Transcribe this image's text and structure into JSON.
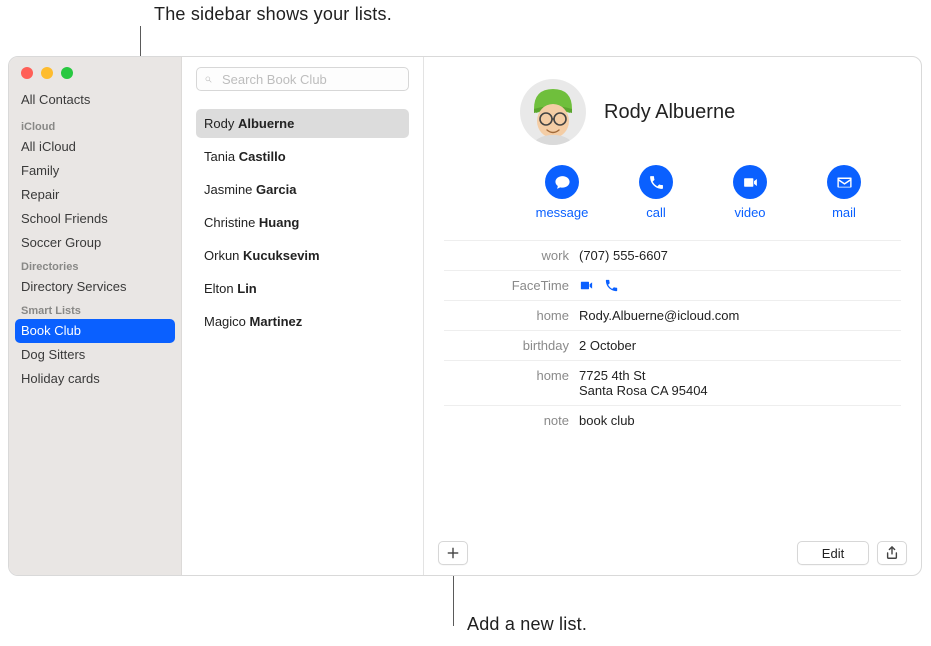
{
  "callouts": {
    "top": "The sidebar shows your lists.",
    "bottom": "Add a new list."
  },
  "sidebar": {
    "all_contacts": "All Contacts",
    "sections": [
      {
        "header": "iCloud",
        "items": [
          "All iCloud",
          "Family",
          "Repair",
          "School Friends",
          "Soccer Group"
        ]
      },
      {
        "header": "Directories",
        "items": [
          "Directory Services"
        ]
      },
      {
        "header": "Smart Lists",
        "items": [
          "Book Club",
          "Dog Sitters",
          "Holiday cards"
        ]
      }
    ],
    "selected": "Book Club"
  },
  "search": {
    "placeholder": "Search Book Club"
  },
  "contacts": [
    {
      "first": "Rody",
      "last": "Albuerne",
      "selected": true
    },
    {
      "first": "Tania",
      "last": "Castillo"
    },
    {
      "first": "Jasmine",
      "last": "Garcia"
    },
    {
      "first": "Christine",
      "last": "Huang"
    },
    {
      "first": "Orkun",
      "last": "Kucuksevim"
    },
    {
      "first": "Elton",
      "last": "Lin"
    },
    {
      "first": "Magico",
      "last": "Martinez"
    }
  ],
  "card": {
    "name": "Rody Albuerne",
    "actions": {
      "message": "message",
      "call": "call",
      "video": "video",
      "mail": "mail"
    },
    "fields": [
      {
        "label": "work",
        "value": "(707) 555-6607"
      },
      {
        "label": "FaceTime",
        "value": "",
        "facetime": true
      },
      {
        "label": "home",
        "value": "Rody.Albuerne@icloud.com"
      },
      {
        "label": "birthday",
        "value": "2 October"
      },
      {
        "label": "home",
        "value": "7725 4th St\nSanta Rosa CA 95404"
      },
      {
        "label": "note",
        "value": "book club"
      }
    ],
    "edit": "Edit"
  }
}
